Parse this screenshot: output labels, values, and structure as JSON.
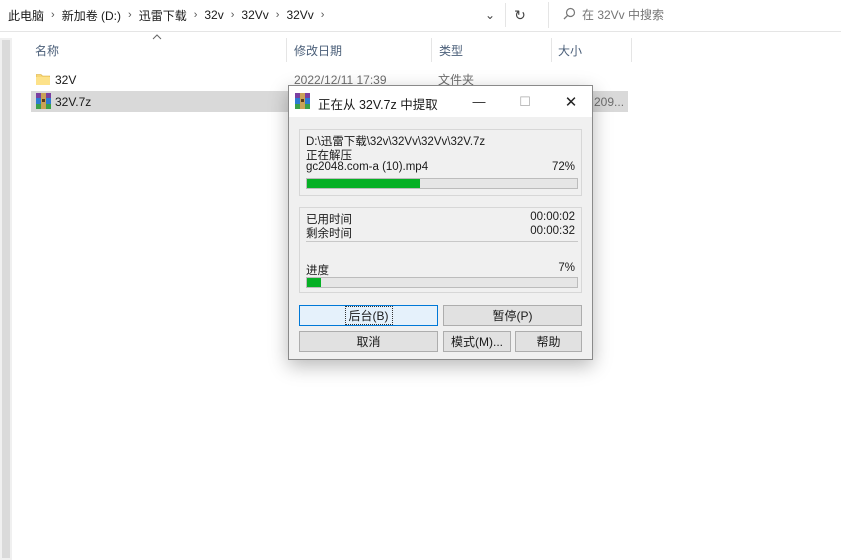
{
  "address": {
    "crumbs": [
      "此电脑",
      "新加卷 (D:)",
      "迅雷下载",
      "32v",
      "32Vv",
      "32Vv"
    ],
    "separator": "›",
    "dropdown_glyph": "⌄",
    "refresh_glyph": "↻"
  },
  "search": {
    "placeholder": "在 32Vv 中搜索",
    "icon": "search-icon"
  },
  "columns": {
    "name": "名称",
    "date": "修改日期",
    "type": "类型",
    "size": "大小"
  },
  "files": [
    {
      "name": "32V",
      "date": "2022/12/11 17:39",
      "type": "文件夹",
      "size": "",
      "icon": "folder-icon"
    },
    {
      "name": "32V.7z",
      "date": "",
      "type": "",
      "size": "209...",
      "icon": "rar-archive-icon"
    }
  ],
  "dialog": {
    "title": "正在从 32V.7z 中提取",
    "window_buttons": {
      "minimize": "—",
      "maximize": "☐",
      "close": "✕"
    },
    "archive_path": "D:\\迅雷下载\\32v\\32Vv\\32Vv\\32V.7z",
    "status": "正在解压",
    "current_file": "gc2048.com-a (10).mp4",
    "file_percent_label": "72%",
    "file_progress": 0.42,
    "elapsed_label": "已用时间",
    "elapsed_value": "00:00:02",
    "remaining_label": "剩余时间",
    "remaining_value": "00:00:32",
    "progress_label": "进度",
    "progress_percent_label": "7%",
    "total_progress": 0.05,
    "buttons": {
      "background": "后台(B)",
      "pause": "暂停(P)",
      "cancel": "取消",
      "mode": "模式(M)...",
      "help": "帮助"
    },
    "colors": {
      "progress_fill": "#06b025",
      "selection": "#cce8ff"
    }
  }
}
